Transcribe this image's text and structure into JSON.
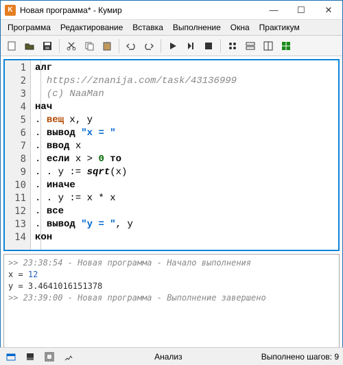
{
  "window": {
    "title": "Новая программа* - Кумир",
    "app_letter": "K"
  },
  "menu": {
    "items": [
      "Программа",
      "Редактирование",
      "Вставка",
      "Выполнение",
      "Окна",
      "Практикум"
    ]
  },
  "toolbar": {
    "icons": [
      "new",
      "open",
      "save",
      "cut",
      "copy",
      "paste",
      "undo",
      "redo",
      "run",
      "step",
      "stop",
      "layout1",
      "layout2",
      "layout3",
      "layout4"
    ]
  },
  "code": {
    "lines": [
      {
        "n": 1,
        "html": "<span class='kw'>алг</span>"
      },
      {
        "n": 2,
        "html": "  <span class='cmt'>https://znanija.com/task/43136999</span>"
      },
      {
        "n": 3,
        "html": "  <span class='cmt'>(c) NaaMan</span>"
      },
      {
        "n": 4,
        "html": "<span class='kw'>нач</span>"
      },
      {
        "n": 5,
        "html": ". <span class='type'>вещ</span> x, y"
      },
      {
        "n": 6,
        "html": ". <span class='kw'>вывод</span> <span class='str'>\"x = \"</span>"
      },
      {
        "n": 7,
        "html": ". <span class='kw'>ввод</span> x"
      },
      {
        "n": 8,
        "html": ". <span class='kw'>если</span> x &gt; <span class='num'>0</span> <span class='kw'>то</span>"
      },
      {
        "n": 9,
        "html": ". . y := <span class='fn'>sqrt</span>(x)"
      },
      {
        "n": 10,
        "html": ". <span class='kw'>иначе</span>"
      },
      {
        "n": 11,
        "html": ". . y := x * x"
      },
      {
        "n": 12,
        "html": ". <span class='kw'>все</span>"
      },
      {
        "n": 13,
        "html": ". <span class='kw'>вывод</span> <span class='str'>\"y = \"</span>, y"
      },
      {
        "n": 14,
        "html": "<span class='kw'>кон</span>"
      }
    ]
  },
  "console": {
    "lines": [
      {
        "cls": "log",
        "text": ">> 23:38:54 - Новая программа - Начало выполнения"
      },
      {
        "cls": "out",
        "text": ""
      },
      {
        "cls": "out",
        "html": "x = <span class='val'>12</span>"
      },
      {
        "cls": "out",
        "text": "y = 3.4641016151378"
      },
      {
        "cls": "out",
        "text": ""
      },
      {
        "cls": "log",
        "text": ">> 23:39:00 - Новая программа - Выполнение завершено"
      }
    ]
  },
  "status": {
    "analysis": "Анализ",
    "steps": "Выполнено шагов: 9"
  }
}
